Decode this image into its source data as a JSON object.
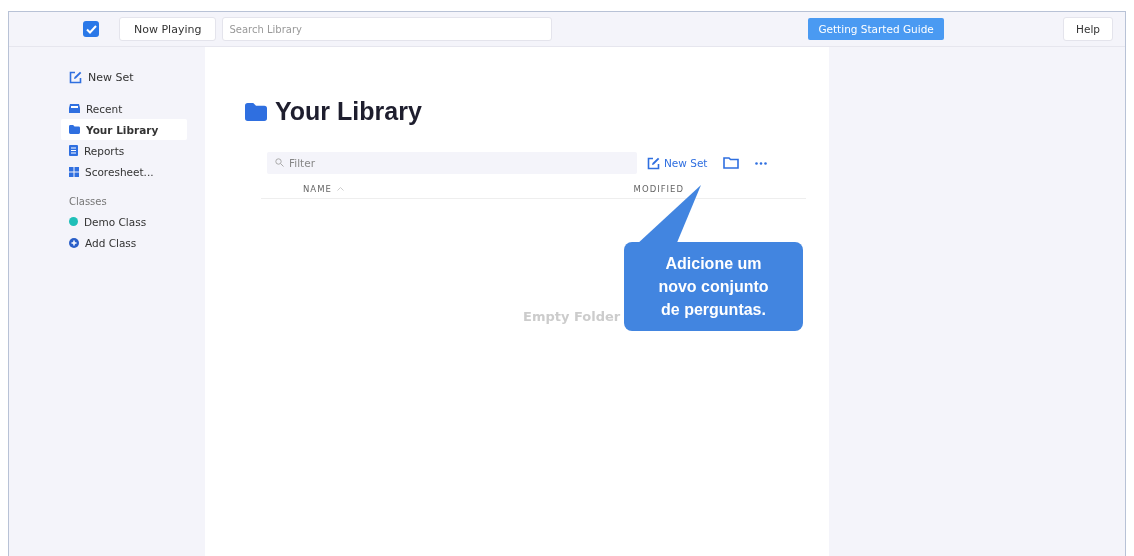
{
  "topbar": {
    "app_checked": true,
    "now_playing": "Now Playing",
    "search": {
      "placeholder": "Search Library"
    },
    "guide": "Getting Started Guide",
    "help": "Help"
  },
  "sidebar": {
    "new_set": "New Set",
    "items": [
      {
        "label": "Recent",
        "kind": "recent",
        "selected": false
      },
      {
        "label": "Your Library",
        "kind": "folder",
        "selected": true
      },
      {
        "label": "Reports",
        "kind": "report",
        "selected": false
      },
      {
        "label": "Scoresheet...",
        "kind": "grid",
        "selected": false
      }
    ],
    "classes_heading": "Classes",
    "classes": [
      {
        "label": "Demo Class",
        "kind": "class",
        "color": "#1fbfb8"
      },
      {
        "label": "Add Class",
        "kind": "add"
      }
    ]
  },
  "main": {
    "title": "Your Library",
    "filter": {
      "placeholder": "Filter"
    },
    "new_set": "New Set",
    "columns": [
      "NAME",
      "MODIFIED"
    ],
    "empty": "Empty Folder"
  },
  "tooltip": {
    "text": "Adicione um novo conjunto de perguntas."
  }
}
